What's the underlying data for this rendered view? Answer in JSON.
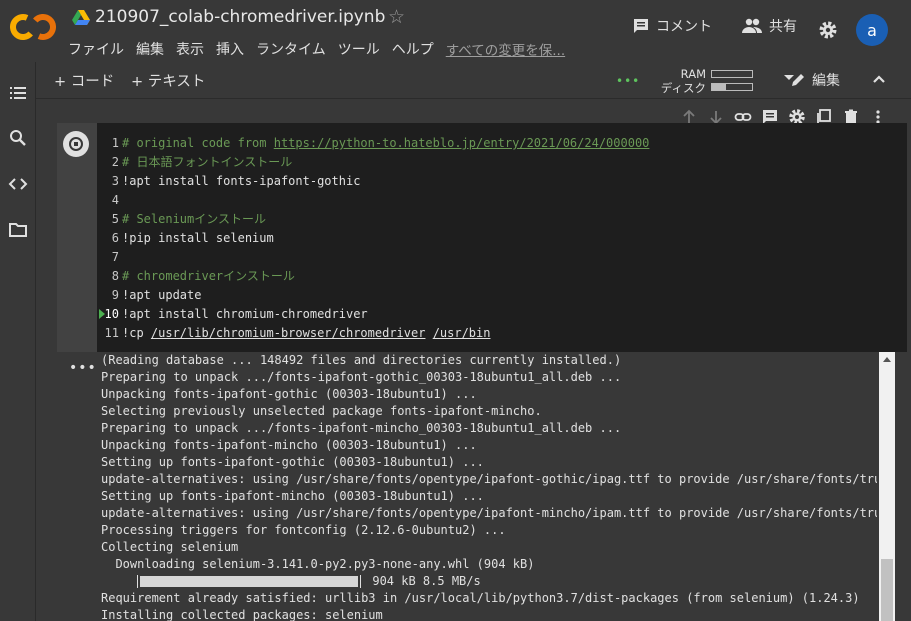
{
  "app": {
    "title": "210907_colab-chromedriver.ipynb",
    "menu": [
      "ファイル",
      "編集",
      "表示",
      "挿入",
      "ランタイム",
      "ツール",
      "ヘルプ"
    ],
    "save_status": "すべての変更を保...",
    "comment_label": "コメント",
    "share_label": "共有",
    "avatar_letter": "a",
    "brand_color": "#f9ab00",
    "avatar_color": "#1a5fb4"
  },
  "toolbar": {
    "add_code": "+ コード",
    "add_text": "+ テキスト",
    "ram_label": "RAM",
    "disk_label": "ディスク",
    "ram_usage": 0.0,
    "disk_usage": 0.35,
    "edit_label": "編集"
  },
  "cell": {
    "lines": [
      {
        "n": "1",
        "parts": [
          {
            "t": "# original code from ",
            "c": "cmt"
          },
          {
            "t": "https://python-to.hateblo.jp/entry/2021/06/24/000000",
            "c": "lnk"
          }
        ]
      },
      {
        "n": "2",
        "parts": [
          {
            "t": "# 日本語フォントインストール",
            "c": "cmt"
          }
        ]
      },
      {
        "n": "3",
        "parts": [
          {
            "t": "!apt install fonts-ipafont-gothic",
            "c": "txt"
          }
        ]
      },
      {
        "n": "4",
        "parts": []
      },
      {
        "n": "5",
        "parts": [
          {
            "t": "# Seleniumインストール",
            "c": "cmt"
          }
        ]
      },
      {
        "n": "6",
        "parts": [
          {
            "t": "!pip install selenium",
            "c": "txt"
          }
        ]
      },
      {
        "n": "7",
        "parts": []
      },
      {
        "n": "8",
        "parts": [
          {
            "t": "# chromedriverインストール",
            "c": "cmt"
          }
        ]
      },
      {
        "n": "9",
        "parts": [
          {
            "t": "!apt update",
            "c": "txt"
          }
        ]
      },
      {
        "n": "10",
        "active": true,
        "parts": [
          {
            "t": "!apt install chromium-chromedriver",
            "c": "txt"
          }
        ]
      },
      {
        "n": "11",
        "parts": [
          {
            "t": "!cp ",
            "c": "txt"
          },
          {
            "t": "/usr/lib/chromium-browser/chromedriver",
            "c": "path"
          },
          {
            "t": " ",
            "c": "txt"
          },
          {
            "t": "/usr/bin",
            "c": "path"
          }
        ]
      }
    ],
    "output_lines": [
      "(Reading database ... 148492 files and directories currently installed.)",
      "Preparing to unpack .../fonts-ipafont-gothic_00303-18ubuntu1_all.deb ...",
      "Unpacking fonts-ipafont-gothic (00303-18ubuntu1) ...",
      "Selecting previously unselected package fonts-ipafont-mincho.",
      "Preparing to unpack .../fonts-ipafont-mincho_00303-18ubuntu1_all.deb ...",
      "Unpacking fonts-ipafont-mincho (00303-18ubuntu1) ...",
      "Setting up fonts-ipafont-gothic (00303-18ubuntu1) ...",
      "update-alternatives: using /usr/share/fonts/opentype/ipafont-gothic/ipag.ttf to provide /usr/share/fonts/truetype",
      "Setting up fonts-ipafont-mincho (00303-18ubuntu1) ...",
      "update-alternatives: using /usr/share/fonts/opentype/ipafont-mincho/ipam.ttf to provide /usr/share/fonts/truetype",
      "Processing triggers for fontconfig (2.12.6-0ubuntu2) ...",
      "Collecting selenium",
      "  Downloading selenium-3.141.0-py2.py3-none-any.whl (904 kB)"
    ],
    "progress_indent": "     ",
    "progress_value": 1.0,
    "progress_text": " 904 kB 8.5 MB/s",
    "output_lines_after": [
      "Requirement already satisfied: urllib3 in /usr/local/lib/python3.7/dist-packages (from selenium) (1.24.3)",
      "Installing collected packages: selenium"
    ]
  }
}
